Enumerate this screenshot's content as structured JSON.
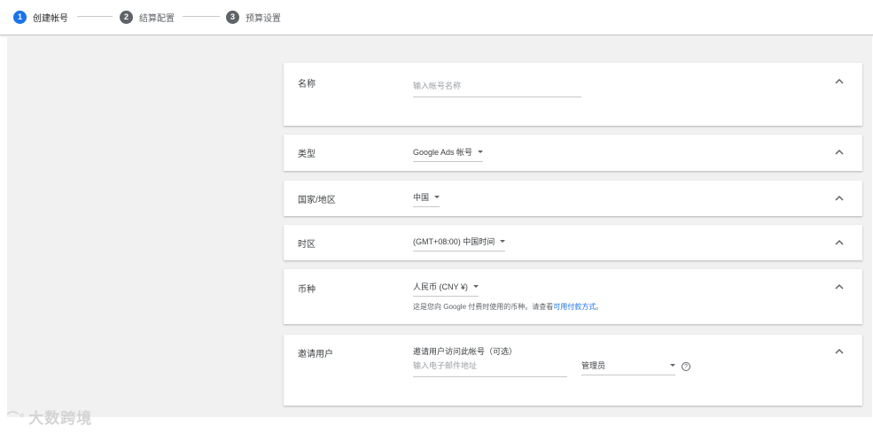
{
  "stepper": {
    "steps": [
      {
        "num": "1",
        "label": "创建帐号",
        "color": "#1a73e8"
      },
      {
        "num": "2",
        "label": "结算配置",
        "color": "#5f6368"
      },
      {
        "num": "3",
        "label": "预算设置",
        "color": "#5f6368"
      }
    ]
  },
  "cards": {
    "name": {
      "label": "名称",
      "placeholder": "输入帐号名称"
    },
    "type": {
      "label": "类型",
      "value": "Google Ads 帐号"
    },
    "country": {
      "label": "国家/地区",
      "value": "中国"
    },
    "timezone": {
      "label": "时区",
      "value": "(GMT+08:00) 中国时间"
    },
    "currency": {
      "label": "币种",
      "value": "人民币 (CNY ¥)",
      "note_text": "这是您向 Google 付费时使用的币种。请查看",
      "note_link": "可用付款方式",
      "note_end": "。"
    },
    "invite": {
      "label": "邀请用户",
      "subtitle": "邀请用户访问此帐号（可选）",
      "email_placeholder": "输入电子邮件地址",
      "role": "管理员",
      "help": "?"
    }
  },
  "watermark": {
    "logo": "⌒°",
    "text": "大数跨境"
  },
  "colors": {
    "accent": "#1a73e8",
    "link": "#1a73e8",
    "background": "#f1f1f1"
  }
}
